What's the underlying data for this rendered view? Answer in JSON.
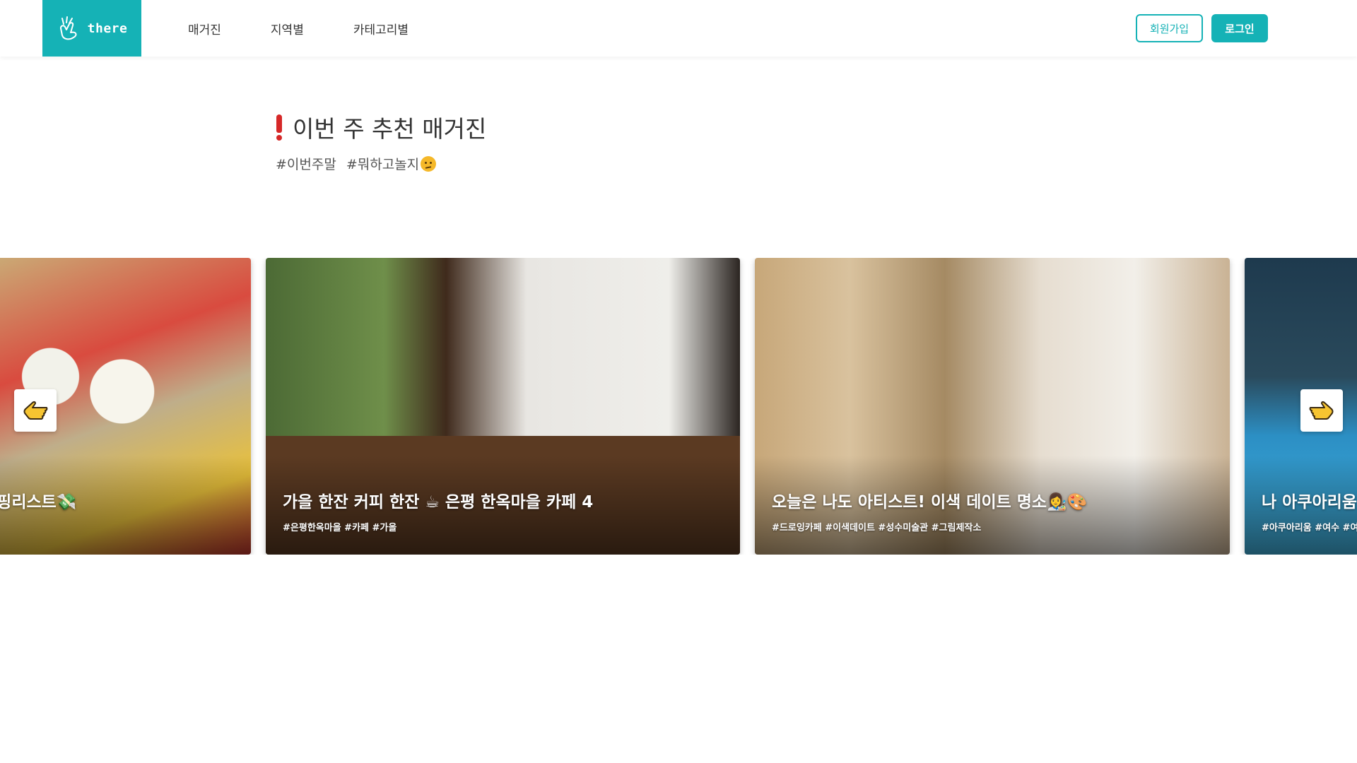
{
  "header": {
    "logo_text": "there",
    "nav": [
      "매거진",
      "지역별",
      "카테고리별"
    ],
    "signup_label": "회원가입",
    "login_label": "로그인"
  },
  "section": {
    "title": "이번 주 추천 매거진",
    "hashtags": [
      "#이번주말",
      "#뭐하고놀지"
    ]
  },
  "cards": [
    {
      "title": "쇼핑리스트💸",
      "tags": ""
    },
    {
      "title": "가을 한잔 커피 한잔 ☕ 은평 한옥마을 카페 4",
      "tags": "#은평한옥마을 #카페 #가을"
    },
    {
      "title": "오늘은 나도 아티스트! 이색 데이트 명소👩‍🎨🎨",
      "tags": "#드로잉카페 #이색데이트 #성수미술관 #그림제작소"
    },
    {
      "title": "나 아쿠아리움",
      "tags": "#아쿠아리움 #여수 #여"
    }
  ],
  "colors": {
    "accent": "#15b2b6"
  },
  "icons": {
    "prev": "pointing-left-icon",
    "next": "pointing-right-icon"
  }
}
